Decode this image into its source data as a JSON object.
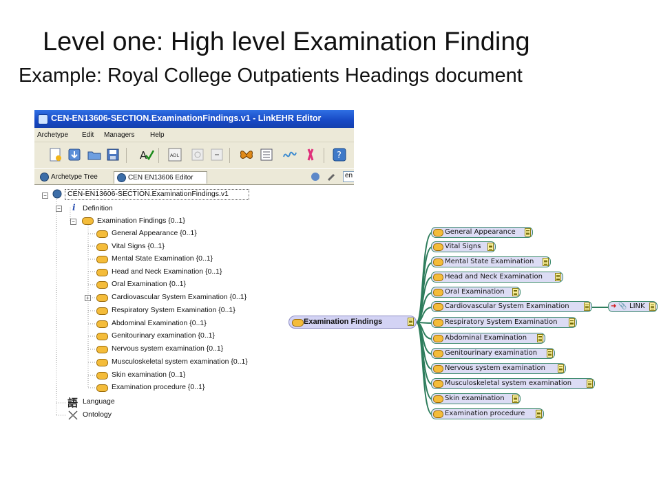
{
  "slide": {
    "title": "Level one: High level Examination Finding",
    "subtitle": "Example: Royal College Outpatients Headings document"
  },
  "editor": {
    "window_title": "CEN-EN13606-SECTION.ExaminationFindings.v1 - LinkEHR Editor",
    "menus": [
      "Archetype",
      "Edit",
      "Managers",
      "Help"
    ],
    "toolbar_icons": [
      "new-archetype-icon",
      "import-icon",
      "open-folder-icon",
      "save-icon",
      "validate-icon",
      "adl-icon",
      "disabled-icon",
      "disabled-icon",
      "butterfly-icon",
      "list-icon",
      "wave-icon",
      "figure-icon",
      "help-icon"
    ],
    "toolbar_icon_colors": {
      "butterfly": "#e08a18",
      "figure": "#e0307a",
      "validate": "#1a8a1a"
    },
    "tabs": [
      {
        "label": "Archetype Tree"
      },
      {
        "label": "CEN EN13606 Editor",
        "active": true
      }
    ],
    "tab_extra_text": "en",
    "tree": {
      "root": "CEN-EN13606-SECTION.ExaminationFindings.v1",
      "definition": "Definition",
      "examination_findings": "Examination Findings {0..1}",
      "children": [
        "General Appearance {0..1}",
        "Vital Signs {0..1}",
        "Mental State Examination {0..1}",
        "Head and Neck Examination {0..1}",
        "Oral Examination {0..1}",
        "Cardiovascular System Examination {0..1}",
        "Respiratory System Examination {0..1}",
        "Abdominal Examination {0..1}",
        "Genitourinary examination {0..1}",
        "Nervous system examination {0..1}",
        "Musculoskeletal system examination {0..1}",
        "Skin examination {0..1}",
        "Examination procedure {0..1}"
      ],
      "language": "Language",
      "ontology": "Ontology"
    }
  },
  "mindmap": {
    "root": "Examination Findings",
    "nodes": [
      "General Appearance",
      "Vital Signs",
      "Mental State Examination",
      "Head and Neck Examination",
      "Oral Examination",
      "Cardiovascular System Examination",
      "Respiratory System Examination",
      "Abdominal Examination",
      "Genitourinary examination",
      "Nervous system examination",
      "Musculoskeletal system examination",
      "Skin examination",
      "Examination procedure"
    ],
    "link_label": "LINK",
    "edge_color": "#2e7d5c",
    "node_fill": "#dcdcf4"
  }
}
